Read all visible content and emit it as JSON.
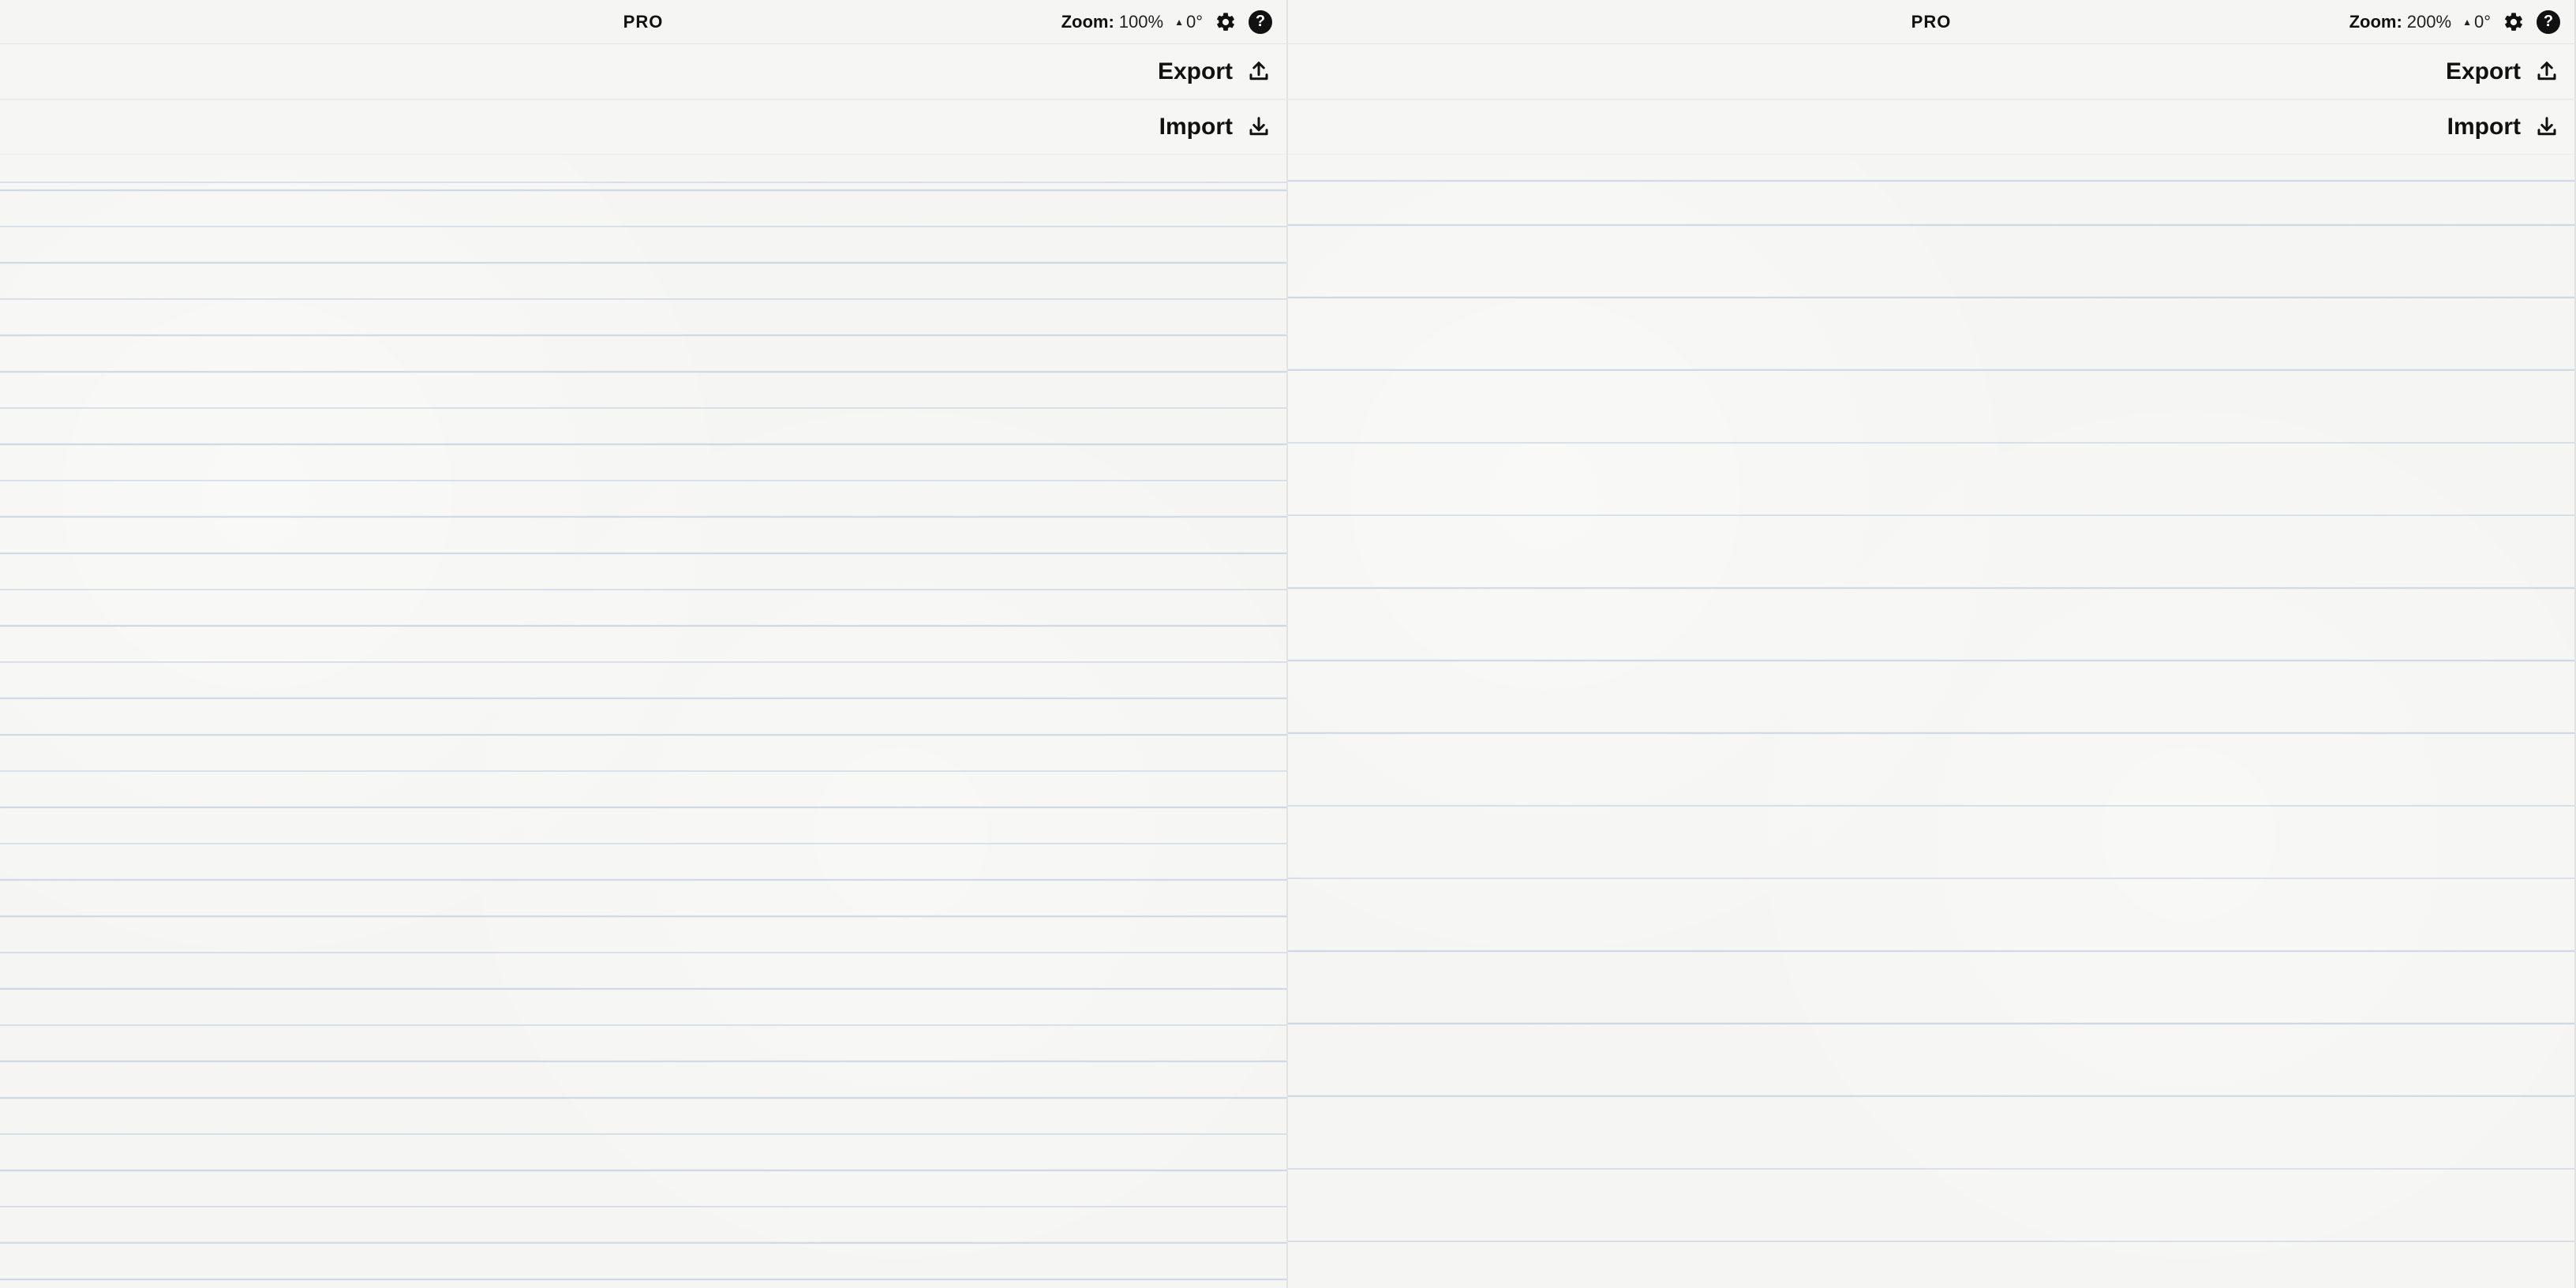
{
  "panes": [
    {
      "header": {
        "title": "PRO",
        "zoom_label": "Zoom:",
        "zoom_value": "100%",
        "rotation_value": "0°"
      },
      "actions": {
        "export_label": "Export",
        "import_label": "Import"
      },
      "paper_zoom_class": "lines-100"
    },
    {
      "header": {
        "title": "PRO",
        "zoom_label": "Zoom:",
        "zoom_value": "200%",
        "rotation_value": "0°"
      },
      "actions": {
        "export_label": "Export",
        "import_label": "Import"
      },
      "paper_zoom_class": "lines-200"
    }
  ],
  "icons": {
    "gear": "gear-icon",
    "help": "help-icon",
    "export": "export-icon",
    "import": "import-icon",
    "rotation_indicator": "rotation-indicator-icon"
  }
}
